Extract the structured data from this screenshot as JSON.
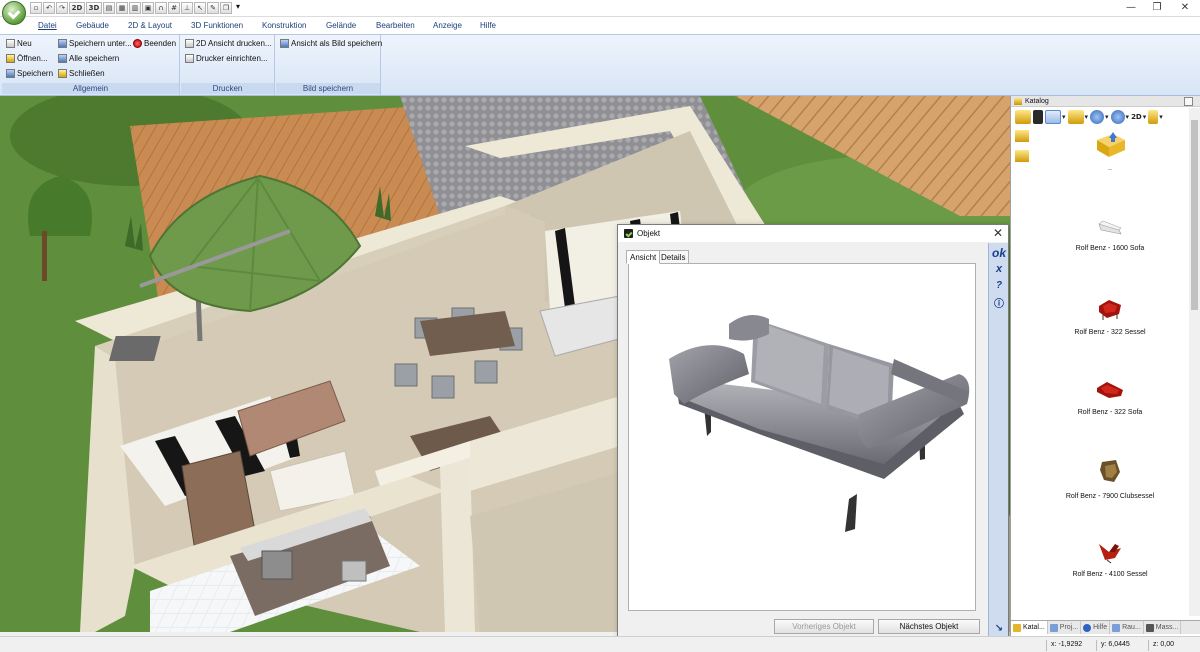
{
  "quick_access": {
    "icons": [
      "new-icon",
      "undo-icon",
      "redo-icon",
      "view-2d-icon",
      "view-3d-icon",
      "plan-icon",
      "wall-icon",
      "table-icon",
      "window-icon",
      "grid-icon",
      "magnet-icon",
      "cursor-icon",
      "paint-icon",
      "copy-icon"
    ],
    "label_2d": "2D",
    "label_3d": "3D",
    "overflow": "▾"
  },
  "window": {
    "minimize": "—",
    "restore": "❐",
    "close": "✕"
  },
  "ribbon_tabs": [
    "Datei",
    "Gebäude",
    "2D & Layout",
    "3D Funktionen",
    "Konstruktion",
    "Gelände",
    "Bearbeiten",
    "Anzeige",
    "Hilfe"
  ],
  "groups": {
    "allgemein": {
      "label": "Allgemein",
      "buttons": {
        "neu": "Neu",
        "oeffnen": "Öffnen...",
        "speichern": "Speichern",
        "speichern_unter": "Speichern unter...",
        "alle_speichern": "Alle speichern",
        "schliessen": "Schließen",
        "beenden": "Beenden"
      }
    },
    "drucken": {
      "label": "Drucken",
      "buttons": {
        "ansicht_drucken": "2D Ansicht drucken...",
        "drucker": "Drucker einrichten..."
      }
    },
    "bild": {
      "label": "Bild speichern",
      "buttons": {
        "ansicht_bild": "Ansicht als Bild speichern"
      }
    }
  },
  "dialog": {
    "title": "Objekt",
    "close": "✕",
    "tabs": {
      "ansicht": "Ansicht",
      "details": "Details"
    },
    "tools": {
      "ok": "ok",
      "cancel": "x",
      "help": "?",
      "info": "ⓘ",
      "resize": "↘"
    },
    "buttons": {
      "prev": "Vorheriges Objekt",
      "next": "Nächstes Objekt"
    }
  },
  "catalog": {
    "title": "Katalog",
    "toolbar": {
      "d2": "2D",
      "arrow": "▾"
    },
    "items": [
      {
        "label": "..",
        "kind": "folder"
      },
      {
        "label": "Rolf Benz - 1600 Sofa",
        "kind": "sofa-white"
      },
      {
        "label": "Rolf Benz - 322 Sessel",
        "kind": "chair-red"
      },
      {
        "label": "Rolf Benz - 322 Sofa",
        "kind": "sofa-red"
      },
      {
        "label": "Rolf Benz - 7900 Clubsessel",
        "kind": "club-brown"
      },
      {
        "label": "Rolf Benz - 4100 Sessel",
        "kind": "chair-red2"
      }
    ],
    "tabs": [
      "Katal...",
      "Proj...",
      "Hilfe",
      "Rau...",
      "Mass..."
    ]
  },
  "status": {
    "x": "x: -1,9292",
    "y": "y: 6,0445",
    "z": "z: 0,00"
  },
  "colors": {
    "accent": "#1e3f78",
    "ribbon": "#dce8f7",
    "grass": "#5c8a38",
    "sofa": "#7e7e86",
    "umbrella": "#6f9a4c"
  }
}
